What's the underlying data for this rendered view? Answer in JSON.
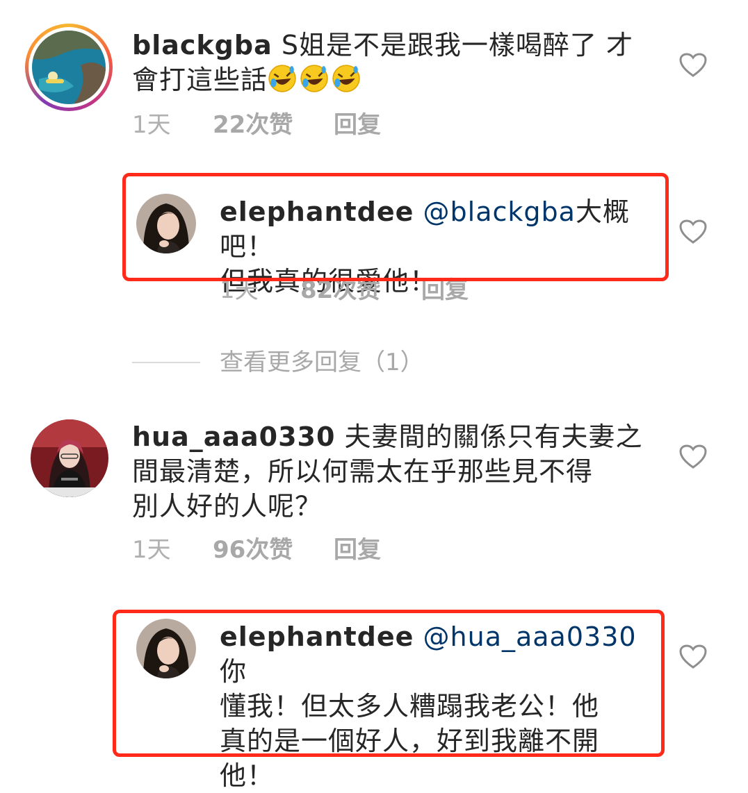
{
  "comments": [
    {
      "username": "blackgba",
      "text": "S姐是不是跟我一樣喝醉了 才",
      "text_line2": "會打這些話",
      "emojis": [
        "rolling-laughing-emoji",
        "rolling-laughing-emoji",
        "rolling-laughing-emoji"
      ],
      "time": "1天",
      "likes": "22次赞",
      "reply_label": "回复"
    },
    {
      "username": "elephantdee",
      "mention": "@blackgba",
      "text_line1_rest": "大概吧！",
      "text_line2": "但我真的很愛他！",
      "time": "1天",
      "likes": "82次赞",
      "reply_label": "回复",
      "highlighted": true
    },
    {
      "username": "hua_aaa0330",
      "text_line1": "夫妻間的關係只有夫妻之",
      "text_line2": "間最清楚，所以何需太在乎那些見不得",
      "text_line3": "別人好的人呢？",
      "time": "1天",
      "likes": "96次赞",
      "reply_label": "回复"
    },
    {
      "username": "elephantdee",
      "mention": "@hua_aaa0330",
      "text_line1_rest": "你",
      "text_line2": "懂我！但太多人糟蹋我老公！他",
      "text_line3": "真的是一個好人，好到我離不開",
      "text_line4": "他！",
      "highlighted": true
    }
  ],
  "view_more_replies": "查看更多回复（1）",
  "colors": {
    "highlight": "#ff2a1a",
    "mention": "#003569",
    "muted": "#a8a8a8"
  },
  "icons": {
    "like": "heart-outline-icon"
  }
}
